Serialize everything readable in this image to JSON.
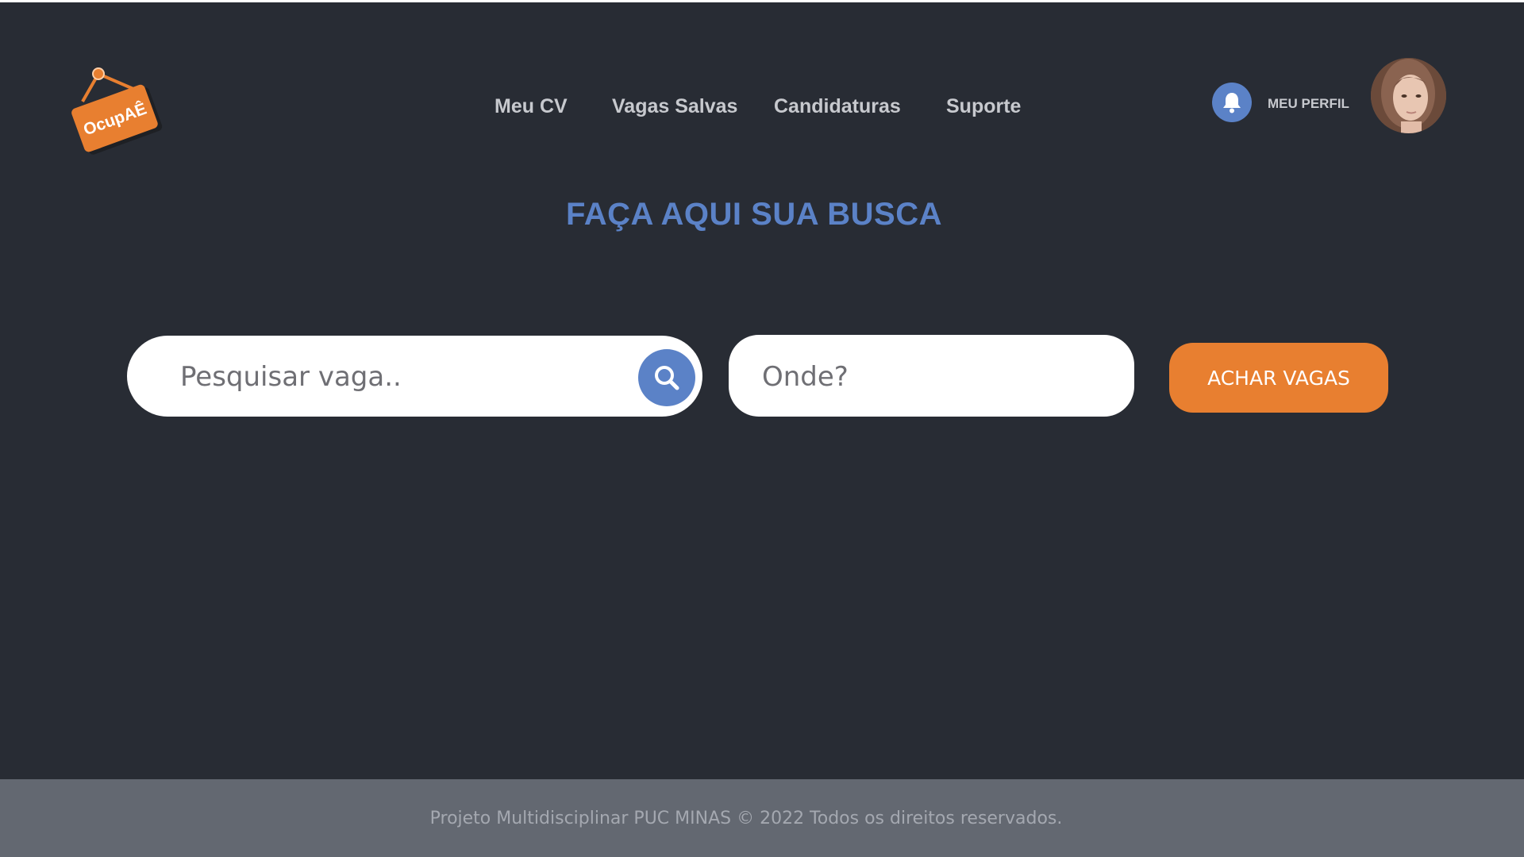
{
  "app": {
    "logo_text": "OcupAÊ"
  },
  "nav": {
    "items": [
      {
        "label": "Meu CV"
      },
      {
        "label": "Vagas Salvas"
      },
      {
        "label": "Candidaturas"
      },
      {
        "label": "Suporte"
      }
    ]
  },
  "header": {
    "profile_label": "MEU PERFIL",
    "bell_icon": "bell-icon"
  },
  "main": {
    "heading": "FAÇA AQUI SUA BUSCA",
    "search": {
      "placeholder": "Pesquisar vaga..",
      "value": ""
    },
    "location": {
      "placeholder": "Onde?",
      "value": ""
    },
    "submit_label": "ACHAR VAGAS"
  },
  "footer": {
    "text": "Projeto Multidisciplinar  PUC MINAS © 2022 Todos os direitos reservados."
  },
  "colors": {
    "background": "#282c34",
    "accent_blue": "#5b82c7",
    "accent_orange": "#e87f30",
    "footer": "#636871"
  }
}
